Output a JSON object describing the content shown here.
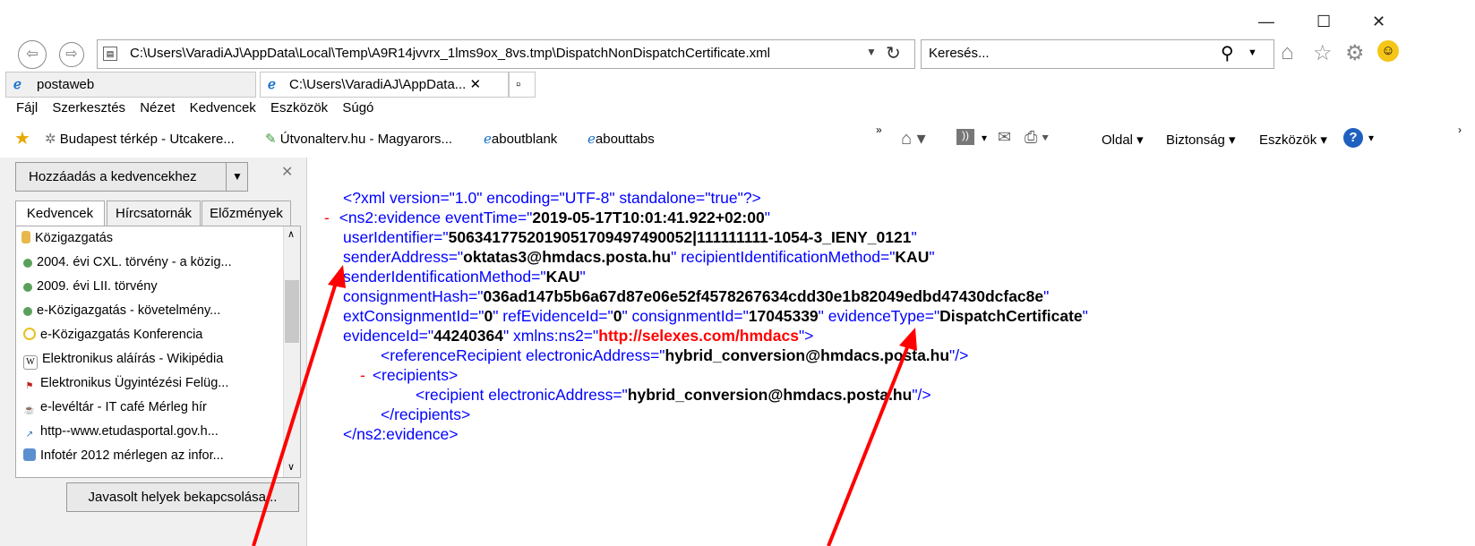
{
  "window": {
    "minimize": "—",
    "maximize": "☐",
    "close": "✕"
  },
  "address": {
    "url": "C:\\Users\\VaradiAJ\\AppData\\Local\\Temp\\A9R14jvvrx_1lms9ox_8vs.tmp\\DispatchNonDispatchCertificate.xml",
    "search_placeholder": "Keresés..."
  },
  "tabs": [
    {
      "label": "postaweb"
    },
    {
      "label": "C:\\Users\\VaradiAJ\\AppData... ✕"
    }
  ],
  "menu": [
    "Fájl",
    "Szerkesztés",
    "Nézet",
    "Kedvencek",
    "Eszközök",
    "Súgó"
  ],
  "favorites_bar": [
    "Budapest térkép - Utcakere...",
    "Útvonalterv.hu - Magyarors...",
    "aboutblank",
    "abouttabs"
  ],
  "command_bar": {
    "page": "Oldal ▾",
    "safety": "Biztonság ▾",
    "tools": "Eszközök ▾"
  },
  "sidebar": {
    "add_button": "Hozzáadás a kedvencekhez",
    "tabs": [
      "Kedvencek",
      "Hírcsatornák",
      "Előzmények"
    ],
    "folder": "Közigazgatás",
    "items": [
      "2004. évi CXL. törvény - a közig...",
      "2009. évi LII. törvény",
      "e-Közigazgatás - követelmény...",
      "e-Közigazgatás Konferencia",
      "Elektronikus aláírás - Wikipédia",
      "Elektronikus Ügyintézési Felüg...",
      "e-levéltár - IT café Mérleg hír",
      "http--www.etudasportal.gov.h...",
      "Infotér 2012 mérlegen az infor..."
    ],
    "suggest_button": "Javasolt helyek bekapcsolása..."
  },
  "xml": {
    "decl": "<?xml version=\"1.0\" encoding=\"UTF-8\" standalone=\"true\"?>",
    "minus": "-",
    "ev_open": "<ns2:evidence eventTime=\"",
    "eventTime": "2019-05-17T10:01:41.922+02:00",
    "userIdentifier_attr": "userIdentifier=\"",
    "userIdentifier": "5063417752019051709497490052|111111111-1054-3_IENY_0121",
    "senderAddress_attr": "senderAddress=\"",
    "senderAddress": "oktatas3@hmdacs.posta.hu",
    "recipientIdMethod_attr": "\" recipientIdentificationMethod=\"",
    "recipientIdMethod": "KAU",
    "senderIdMethod_attr": "senderIdentificationMethod=\"",
    "senderIdMethod": "KAU",
    "consignmentHash_attr": "consignmentHash=\"",
    "consignmentHash": "036ad147b5b6a67d87e06e52f4578267634cdd30e1b82049edbd47430dcfac8e",
    "extConsignmentId_attr": "extConsignmentId=\"",
    "extConsignmentId": "0",
    "refEvidenceId_attr": "\" refEvidenceId=\"",
    "refEvidenceId": "0",
    "consignmentId_attr": "\" consignmentId=\"",
    "consignmentId": "17045339",
    "evidenceType_attr": "\" evidenceType=\"",
    "evidenceType": "DispatchCertificate",
    "evidenceId_attr": "evidenceId=\"",
    "evidenceId": "44240364",
    "xmlns_attr": "\" xmlns:ns2=\"",
    "xmlns": "http://selexes.com/hmdacs",
    "ev_open_end": "\">",
    "refRecip_open": "<referenceRecipient electronicAddress=\"",
    "refRecip_addr": "hybrid_conversion@hmdacs.posta.hu",
    "self_close": "\"/>",
    "recipients_open": "<recipients>",
    "recip_open": "<recipient electronicAddress=\"",
    "recip_addr": "hybrid_conversion@hmdacs.posta.hu",
    "recipients_close": "</recipients>",
    "ev_close": "</ns2:evidence>",
    "quote": "\""
  }
}
